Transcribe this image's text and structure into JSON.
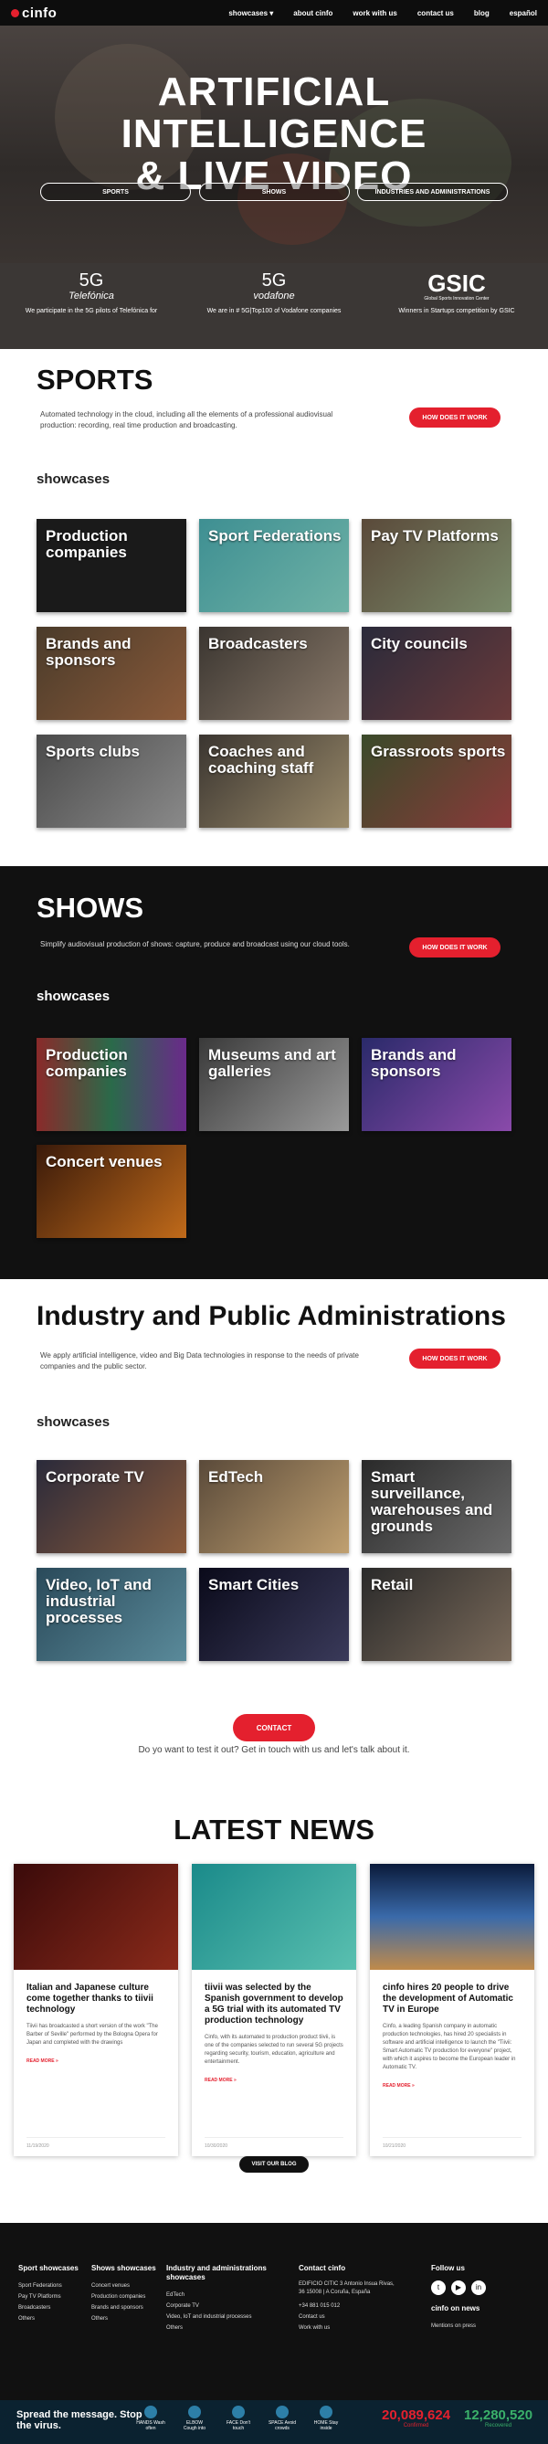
{
  "nav": {
    "logo": "cinfo",
    "items": [
      "showcases ▾",
      "about cinfo",
      "work with us",
      "contact us",
      "blog",
      "español"
    ]
  },
  "hero": {
    "title_1": "ARTIFICIAL INTELLIGENCE",
    "title_2": "& LIVE VIDEO",
    "buttons": [
      "SPORTS",
      "SHOWS",
      "INDUSTRIES AND ADMINISTRATIONS"
    ]
  },
  "partners": [
    {
      "badge": "5G",
      "name": "Telefónica",
      "text": "We participate in the 5G pilots of Telefónica for"
    },
    {
      "badge": "5G",
      "name": "vodafone",
      "text": "We are in # 5G|Top100 of Vodafone companies"
    },
    {
      "badge": "GSIC",
      "name": "Global Sports Innovation Center",
      "text": "Winners in Startups competition by GSIC"
    }
  ],
  "sports": {
    "title": "SPORTS",
    "desc": "Automated technology in the cloud, including all the elements of a professional audiovisual production: recording, real time production and broadcasting.",
    "button": "HOW DOES IT WORK",
    "showcases": "showcases",
    "tiles": [
      "Production companies",
      "Sport Federations",
      "Pay TV Platforms",
      "Brands and sponsors",
      "Broadcasters",
      "City councils",
      "Sports clubs",
      "Coaches and coaching staff",
      "Grassroots sports"
    ]
  },
  "shows": {
    "title": "SHOWS",
    "desc": "Simplify audiovisual production of shows: capture, produce and broadcast using our cloud tools.",
    "button": "HOW DOES IT WORK",
    "showcases": "showcases",
    "tiles": [
      "Production companies",
      "Museums and art galleries",
      "Brands and sponsors",
      "Concert venues"
    ]
  },
  "industry": {
    "title": "Industry and Public Administrations",
    "desc": "We apply artificial intelligence, video and Big Data technologies in response to the needs of private companies and the public sector.",
    "button": "HOW DOES IT WORK",
    "showcases": "showcases",
    "tiles": [
      "Corporate TV",
      "EdTech",
      "Smart surveillance, warehouses and grounds",
      "Video, IoT and industrial processes",
      "Smart Cities",
      "Retail"
    ]
  },
  "contact": {
    "button": "CONTACT",
    "text": "Do yo want to test it out? Get in touch with us and let's talk about it."
  },
  "news": {
    "title": "LATEST NEWS",
    "button": "VISIT OUR BLOG",
    "cards": [
      {
        "title": "Italian and Japanese culture come together thanks to tiivii technology",
        "text": "Tiivii has broadcasted a short version of the work \"The Barber of Seville\" performed by the Bologna Opera for Japan and completed with the drawings",
        "read": "READ MORE »",
        "date": "11/19/2020"
      },
      {
        "title": "tiivii was selected by the Spanish government to develop a 5G trial with its automated TV production technology",
        "text": "Cinfo, with its automated to production product tiivii, is one of the companies selected to run several 5G projects regarding security, tourism, education, agriculture and entertainment.",
        "read": "READ MORE »",
        "date": "10/30/2020"
      },
      {
        "title": "cinfo hires 20 people to drive the development of Automatic TV in Europe",
        "text": "Cinfo, a leading Spanish company in automatic production technologies, has hired 20 specialists in software and artificial intelligence to launch the \"Tiivii: Smart Automatic TV production for everyone\" project, with which it aspires to become the European leader in Automatic TV.",
        "read": "READ MORE »",
        "date": "10/21/2020"
      }
    ]
  },
  "footer": {
    "sport": {
      "title": "Sport showcases",
      "items": [
        "Sport Federations",
        "Pay TV Platforms",
        "Broadcasters",
        "Others"
      ]
    },
    "shows": {
      "title": "Shows showcases",
      "items": [
        "Concert venues",
        "Production companies",
        "Brands and sponsors",
        "Others"
      ]
    },
    "industry": {
      "title": "Industry and administrations showcases",
      "items": [
        "EdTech",
        "Corporate TV",
        "Video, IoT and industrial processes",
        "Others"
      ]
    },
    "contact": {
      "title": "Contact cinfo",
      "address": "EDIFICIO CITIC 3 Antonio Insua Rivas, 36 15008 | A Coruña, España",
      "phone": "+34 881 015 012",
      "contact": "Contact us",
      "work": "Work with us"
    },
    "follow": {
      "title": "Follow us",
      "news_title": "cinfo on news",
      "news_link": "Mentions on press"
    }
  },
  "covid": {
    "msg_1": "Spread the message. Stop",
    "msg_2": "the virus.",
    "icons": [
      "HANDS Wash often",
      "ELBOW Cough into",
      "FACE Don't touch",
      "SPACE Avoid crowds",
      "HOME Stay inside"
    ],
    "confirmed": "20,089,624",
    "confirmed_label": "Confirmed",
    "recovered": "12,280,520",
    "recovered_label": "Recovered"
  }
}
